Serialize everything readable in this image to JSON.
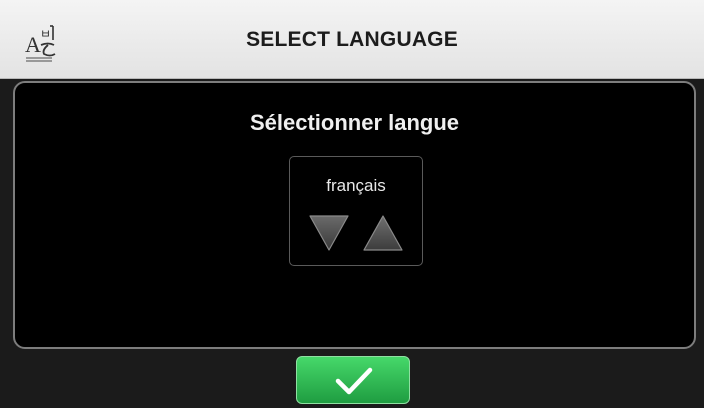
{
  "header": {
    "title": "SELECT LANGUAGE",
    "icon": "language-icon"
  },
  "panel": {
    "title": "Sélectionner langue"
  },
  "language_selector": {
    "value": "français",
    "down_icon": "triangle-down-icon",
    "up_icon": "triangle-up-icon"
  },
  "confirm": {
    "icon": "checkmark-icon"
  },
  "colors": {
    "header_bg": "#ebebeb",
    "screen_bg": "#1b1b1b",
    "panel_bg": "#000000",
    "confirm_green": "#2fbf55"
  }
}
